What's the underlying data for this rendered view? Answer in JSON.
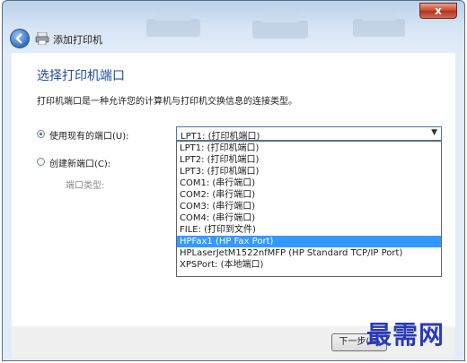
{
  "window": {
    "title": "添加打印机",
    "close_label": "x"
  },
  "page": {
    "heading": "选择打印机端口",
    "description": "打印机端口是一种允许您的计算机与打印机交换信息的连接类型。"
  },
  "port_choice": {
    "existing_label": "使用现有的端口(U):",
    "new_label": "创建新端口(C):",
    "port_type_label": "端口类型:",
    "selected_value": "LPT1: (打印机端口)",
    "options": [
      "LPT1: (打印机端口)",
      "LPT2: (打印机端口)",
      "LPT3: (打印机端口)",
      "COM1: (串行端口)",
      "COM2: (串行端口)",
      "COM3: (串行端口)",
      "COM4: (串行端口)",
      "FILE: (打印到文件)",
      "HPFax1 (HP Fax Port)",
      "HPLaserJetM1522nfMFP (HP Standard TCP/IP Port)",
      "XPSPort: (本地端口)"
    ],
    "highlighted_index": 8
  },
  "footer": {
    "next_label": "下一步(N)"
  },
  "watermark": "最需网"
}
